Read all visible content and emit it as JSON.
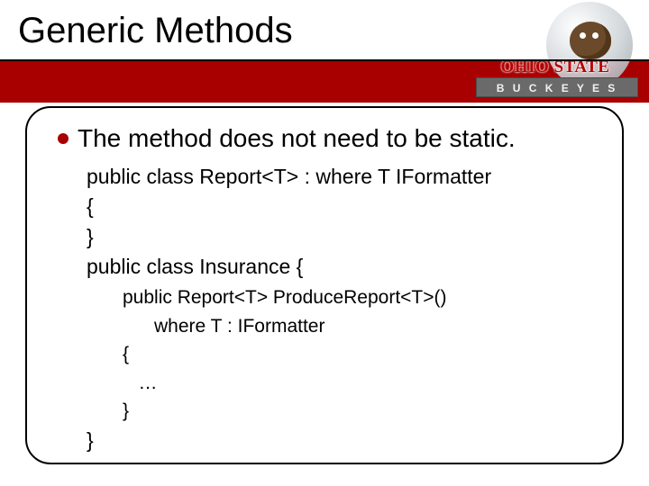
{
  "title": "Generic Methods",
  "logo": {
    "line1": "OHIO STATE",
    "plate": "B U C K E Y E S"
  },
  "bullet": "The method does not need to be static.",
  "code1": {
    "l1": "public class Report<T> : where T IFormatter",
    "l2": "{",
    "l3": "}",
    "l4": "public class Insurance {"
  },
  "code2": {
    "l1": "public Report<T> ProduceReport<T>()",
    "l2": "      where T : IFormatter",
    "l3": "{",
    "l4": "   …",
    "l5": "}",
    "l6_outer": "}"
  }
}
